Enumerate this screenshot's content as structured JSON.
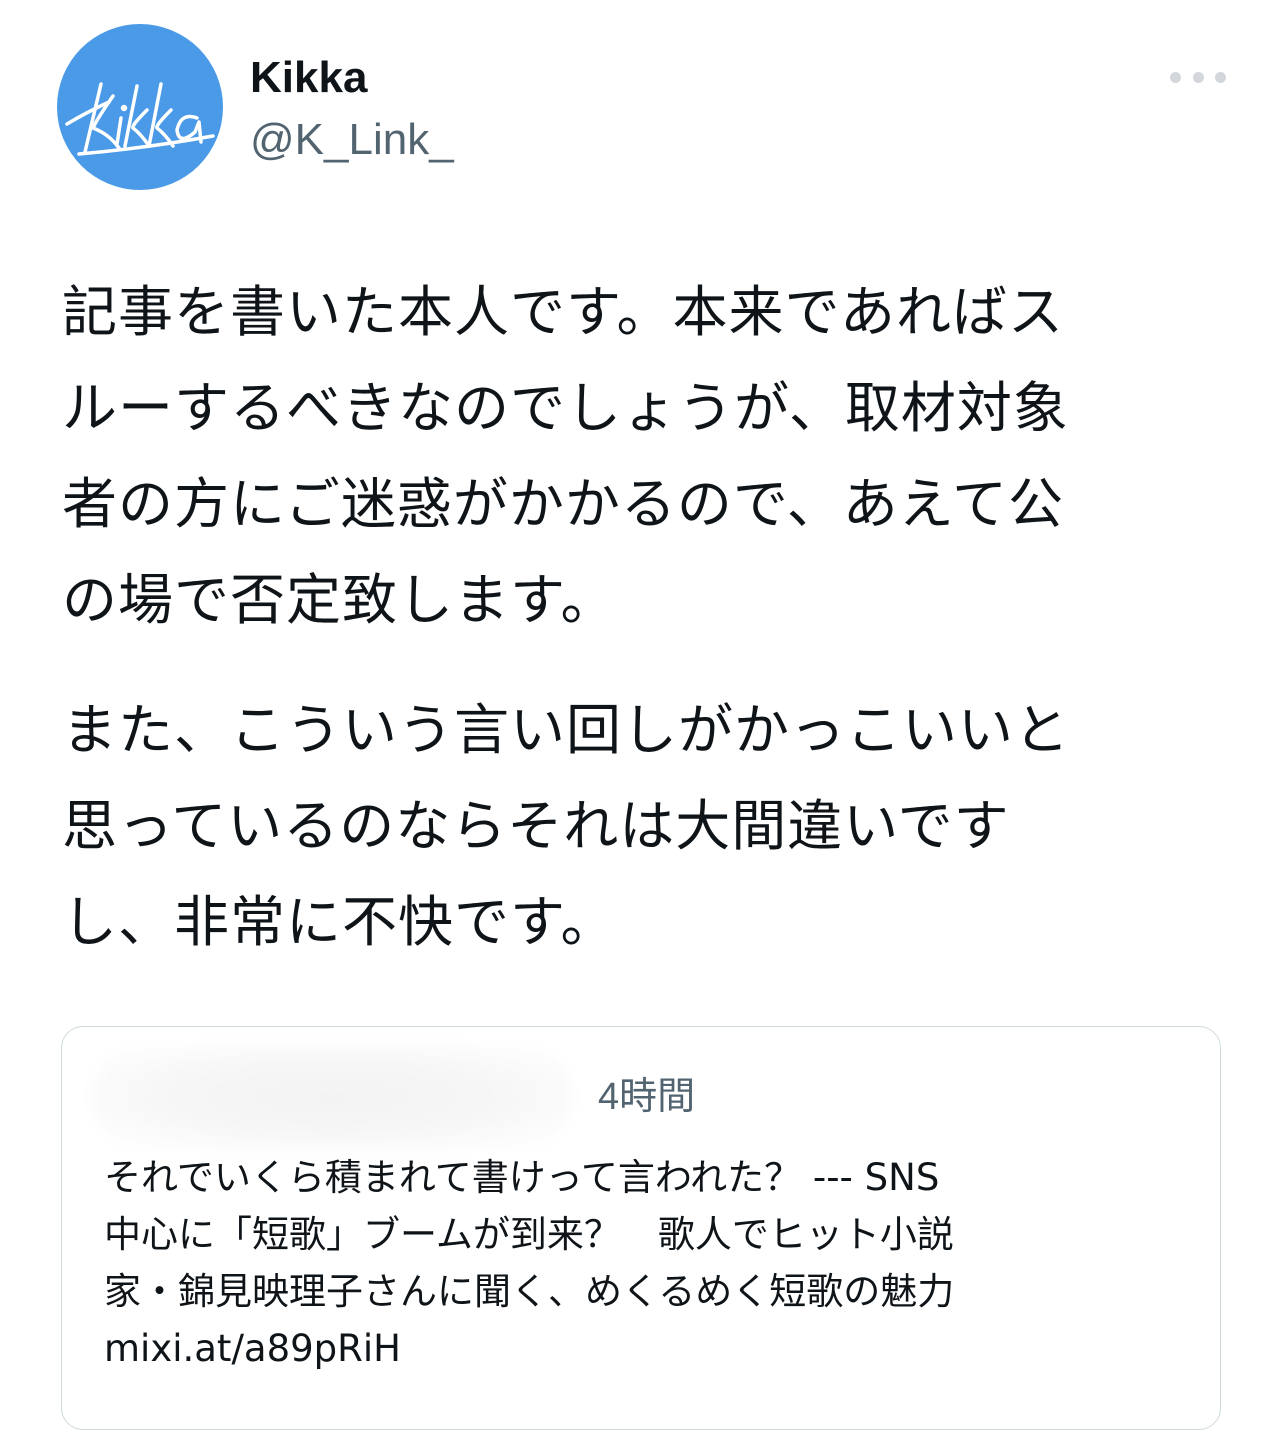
{
  "author": {
    "avatar_text": "Kikka",
    "display_name": "Kikka",
    "handle": "@K_Link_"
  },
  "more_icon": "more-horizontal-icon",
  "tweet": {
    "paragraphs": [
      [
        "記事を書いた本人です。本来であればス",
        "ルーするべきなのでしょうが、取材対象",
        "者の方にご迷惑がかかるので、あえて公",
        "の場で否定致します。"
      ],
      [
        "また、こういう言い回しがかっこいいと",
        "思っているのならそれは大間違いです",
        "し、非常に不快です。"
      ]
    ]
  },
  "quoted_tweet": {
    "time": "4時間",
    "text_lines": [
      "それでいくら積まれて書けって言われた？ --- SNS",
      "中心に「短歌」ブームが到来？　歌人でヒット小説",
      "家・錦見映理子さんに聞く、めくるめく短歌の魅力",
      "mixi.at/a89pRiH"
    ]
  },
  "colors": {
    "avatar_bg": "#4a9ae8",
    "text_primary": "#0f1419",
    "text_secondary": "#536471",
    "border": "#cfd9de"
  }
}
